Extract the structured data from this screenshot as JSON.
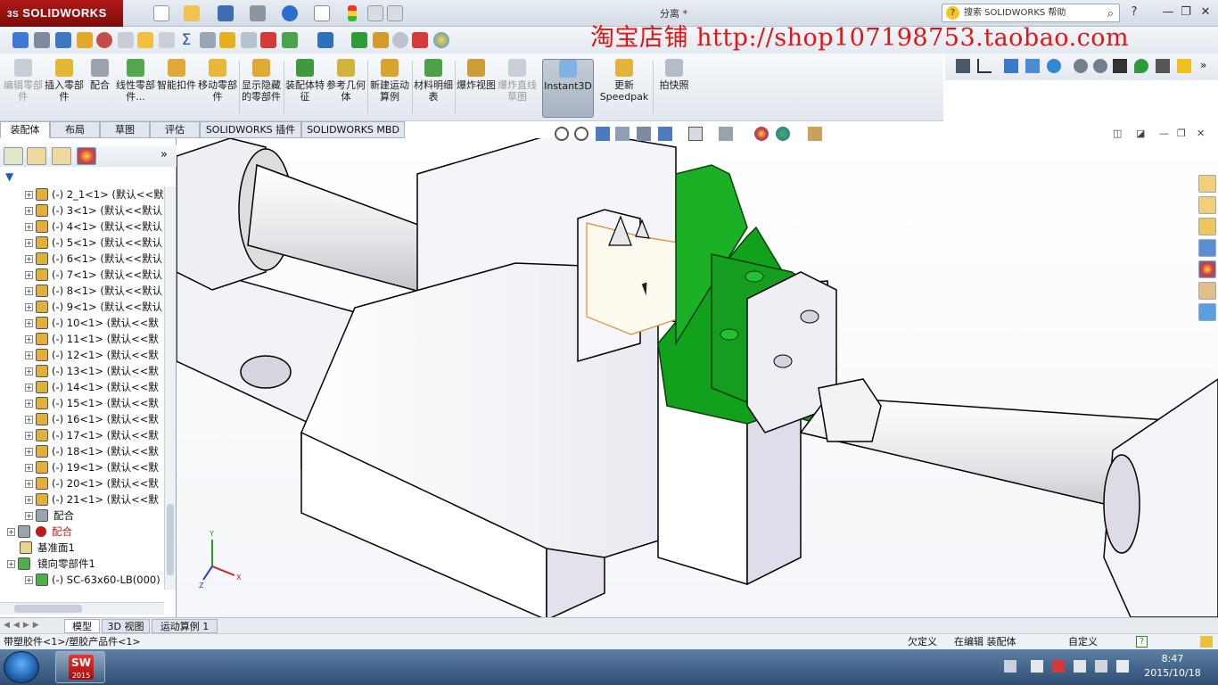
{
  "titlebar": {
    "brand": "SOLIDWORKS",
    "brand_prefix": "3S",
    "doc_title": "分离 *",
    "help_placeholder": "搜索 SOLIDWORKS 帮助",
    "help_icon": "question-icon",
    "window_buttons": [
      "?",
      "—",
      "❐",
      "✕"
    ]
  },
  "watermark": "淘宝店铺 http://shop107198753.taobao.com",
  "command_manager": {
    "items": [
      {
        "label": "编辑零部件",
        "enabled": false
      },
      {
        "label": "插入零部件",
        "enabled": true
      },
      {
        "label": "配合",
        "enabled": true
      },
      {
        "label": "线性零部件...",
        "enabled": true
      },
      {
        "label": "智能扣件",
        "enabled": true
      },
      {
        "label": "移动零部件",
        "enabled": true
      },
      {
        "label": "显示隐藏的零部件",
        "enabled": true
      },
      {
        "label": "装配体特征",
        "enabled": true
      },
      {
        "label": "参考几何体",
        "enabled": true
      },
      {
        "label": "新建运动算例",
        "enabled": true
      },
      {
        "label": "材料明细表",
        "enabled": true
      },
      {
        "label": "爆炸视图",
        "enabled": true
      },
      {
        "label": "爆炸直线草图",
        "enabled": false
      },
      {
        "label": "Instant3D",
        "enabled": true,
        "active": true
      },
      {
        "label": "更新Speedpak",
        "enabled": true
      },
      {
        "label": "拍快照",
        "enabled": true
      }
    ]
  },
  "tabs": [
    "装配体",
    "布局",
    "草图",
    "评估",
    "SOLIDWORKS 插件",
    "SOLIDWORKS MBD"
  ],
  "active_tab": "装配体",
  "tree": {
    "nodes": [
      {
        "label": "(-) 2_1<1> (默认<<默认",
        "type": "part"
      },
      {
        "label": "(-) 3<1> (默认<<默认",
        "type": "part"
      },
      {
        "label": "(-) 4<1> (默认<<默认",
        "type": "part"
      },
      {
        "label": "(-) 5<1> (默认<<默认",
        "type": "part"
      },
      {
        "label": "(-) 6<1> (默认<<默认",
        "type": "part"
      },
      {
        "label": "(-) 7<1> (默认<<默认",
        "type": "part"
      },
      {
        "label": "(-) 8<1> (默认<<默认",
        "type": "part"
      },
      {
        "label": "(-) 9<1> (默认<<默认",
        "type": "part"
      },
      {
        "label": "(-) 10<1> (默认<<默",
        "type": "part"
      },
      {
        "label": "(-) 11<1> (默认<<默",
        "type": "part"
      },
      {
        "label": "(-) 12<1> (默认<<默",
        "type": "part"
      },
      {
        "label": "(-) 13<1> (默认<<默",
        "type": "part"
      },
      {
        "label": "(-) 14<1> (默认<<默",
        "type": "part"
      },
      {
        "label": "(-) 15<1> (默认<<默",
        "type": "part"
      },
      {
        "label": "(-) 16<1> (默认<<默",
        "type": "part"
      },
      {
        "label": "(-) 17<1> (默认<<默",
        "type": "part"
      },
      {
        "label": "(-) 18<1> (默认<<默",
        "type": "part"
      },
      {
        "label": "(-) 19<1> (默认<<默",
        "type": "part"
      },
      {
        "label": "(-) 20<1> (默认<<默",
        "type": "part"
      },
      {
        "label": "(-) 21<1> (默认<<默",
        "type": "part"
      },
      {
        "label": "配合",
        "type": "mates-sub"
      },
      {
        "label": "配合",
        "type": "mates-error"
      },
      {
        "label": "基准面1",
        "type": "plane"
      },
      {
        "label": "镜向零部件1",
        "type": "mirror"
      },
      {
        "label": "(-) SC-63x60-LB(000)",
        "type": "part-child"
      }
    ]
  },
  "bottom_tabs": [
    "模型",
    "3D 视图",
    "运动算例 1"
  ],
  "active_bottom_tab": "模型",
  "status": {
    "left": "带塑胶件<1>/塑胶产品件<1>",
    "under_defined": "欠定义",
    "editing": "在编辑 装配体",
    "custom": "自定义"
  },
  "taskbar": {
    "app_label": "2015",
    "time": "8:47",
    "date": "2015/10/18"
  },
  "colors": {
    "brand_red": "#9b1111",
    "green_part": "#12a11d",
    "watermark": "#e41414"
  }
}
